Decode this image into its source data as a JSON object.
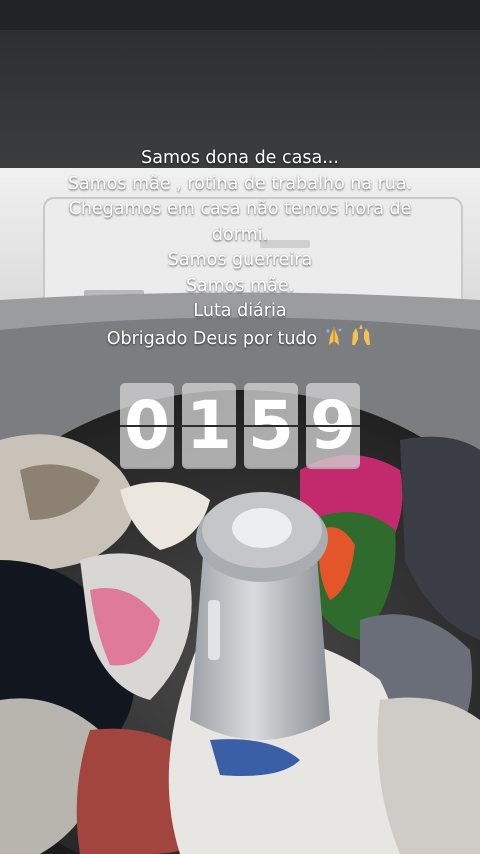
{
  "caption": {
    "lines": [
      "Samos dona de casa...",
      "Samos mãe , rotina de trabalho na rua.",
      "Chegamos em casa não temos hora de dormi.",
      "Samos guerreira",
      "Samos mãe.",
      "Luta diária",
      "Obrigado Deus por tudo"
    ],
    "emoji": [
      "praying-hands-icon",
      "raising-hands-icon"
    ]
  },
  "timer": {
    "digits": [
      "0",
      "1",
      "5",
      "9"
    ]
  }
}
